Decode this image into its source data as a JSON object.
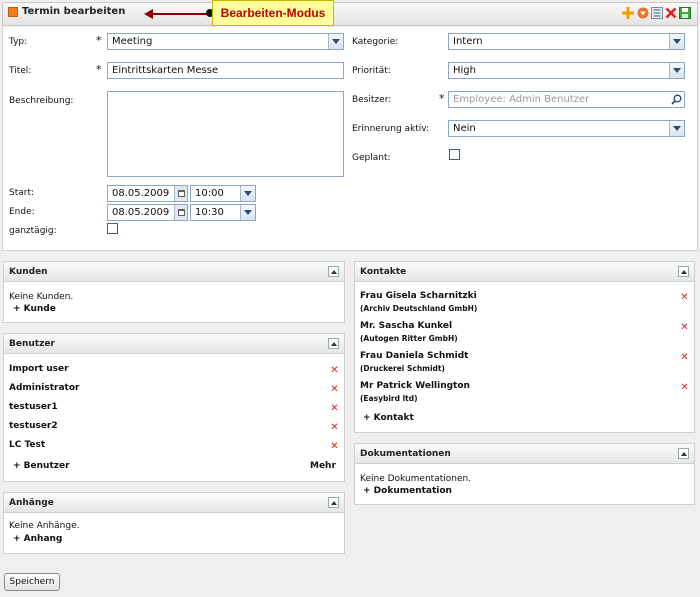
{
  "header": {
    "title": "Termin bearbeiten",
    "callout": "Bearbeiten-Modus",
    "icons": [
      "add-icon",
      "down-circle-icon",
      "list-icon",
      "delete-icon",
      "save-icon"
    ]
  },
  "form": {
    "typ": {
      "label": "Typ:",
      "value": "Meeting"
    },
    "titel": {
      "label": "Titel:",
      "value": "Eintrittskarten Messe"
    },
    "beschreibung": {
      "label": "Beschreibung:",
      "value": ""
    },
    "start": {
      "label": "Start:",
      "date": "08.05.2009",
      "time": "10:00"
    },
    "ende": {
      "label": "Ende:",
      "date": "08.05.2009",
      "time": "10:30"
    },
    "ganztaegig": {
      "label": "ganztägig:"
    },
    "kategorie": {
      "label": "Kategorie:",
      "value": "Intern"
    },
    "prioritaet": {
      "label": "Priorität:",
      "value": "High"
    },
    "besitzer": {
      "label": "Besitzer:",
      "placeholder": "Employee: Admin Benutzer"
    },
    "erinnerung": {
      "label": "Erinnerung aktiv:",
      "value": "Nein"
    },
    "geplant": {
      "label": "Geplant:"
    },
    "required_mark": "*"
  },
  "kunden": {
    "title": "Kunden",
    "empty": "Keine Kunden.",
    "add": "+ Kunde"
  },
  "benutzer": {
    "title": "Benutzer",
    "items": [
      "Import user",
      "Administrator",
      "testuser1",
      "testuser2",
      "LC Test"
    ],
    "add": "+ Benutzer",
    "more": "Mehr"
  },
  "anhaenge": {
    "title": "Anhänge",
    "empty": "Keine Anhänge.",
    "add": "+ Anhang"
  },
  "kontakte": {
    "title": "Kontakte",
    "items": [
      {
        "name": "Frau Gisela Scharnitzki",
        "company": "(Archiv Deutschland GmbH)"
      },
      {
        "name": "Mr. Sascha Kunkel",
        "company": "(Autogen Ritter GmbH)"
      },
      {
        "name": "Frau Daniela Schmidt",
        "company": "(Druckerei Schmidt)"
      },
      {
        "name": "Mr Patrick Wellington",
        "company": "(Easybird ltd)"
      }
    ],
    "add": "+ Kontakt"
  },
  "dokumentationen": {
    "title": "Dokumentationen",
    "empty": "Keine Dokumentationen.",
    "add": "+ Dokumentation"
  },
  "footer": {
    "save_label": "Speichern"
  },
  "colors": {
    "accent": "#f07d1c",
    "delete": "#e02020",
    "callout_bg": "#ffff9c",
    "callout_text": "#c00000"
  }
}
